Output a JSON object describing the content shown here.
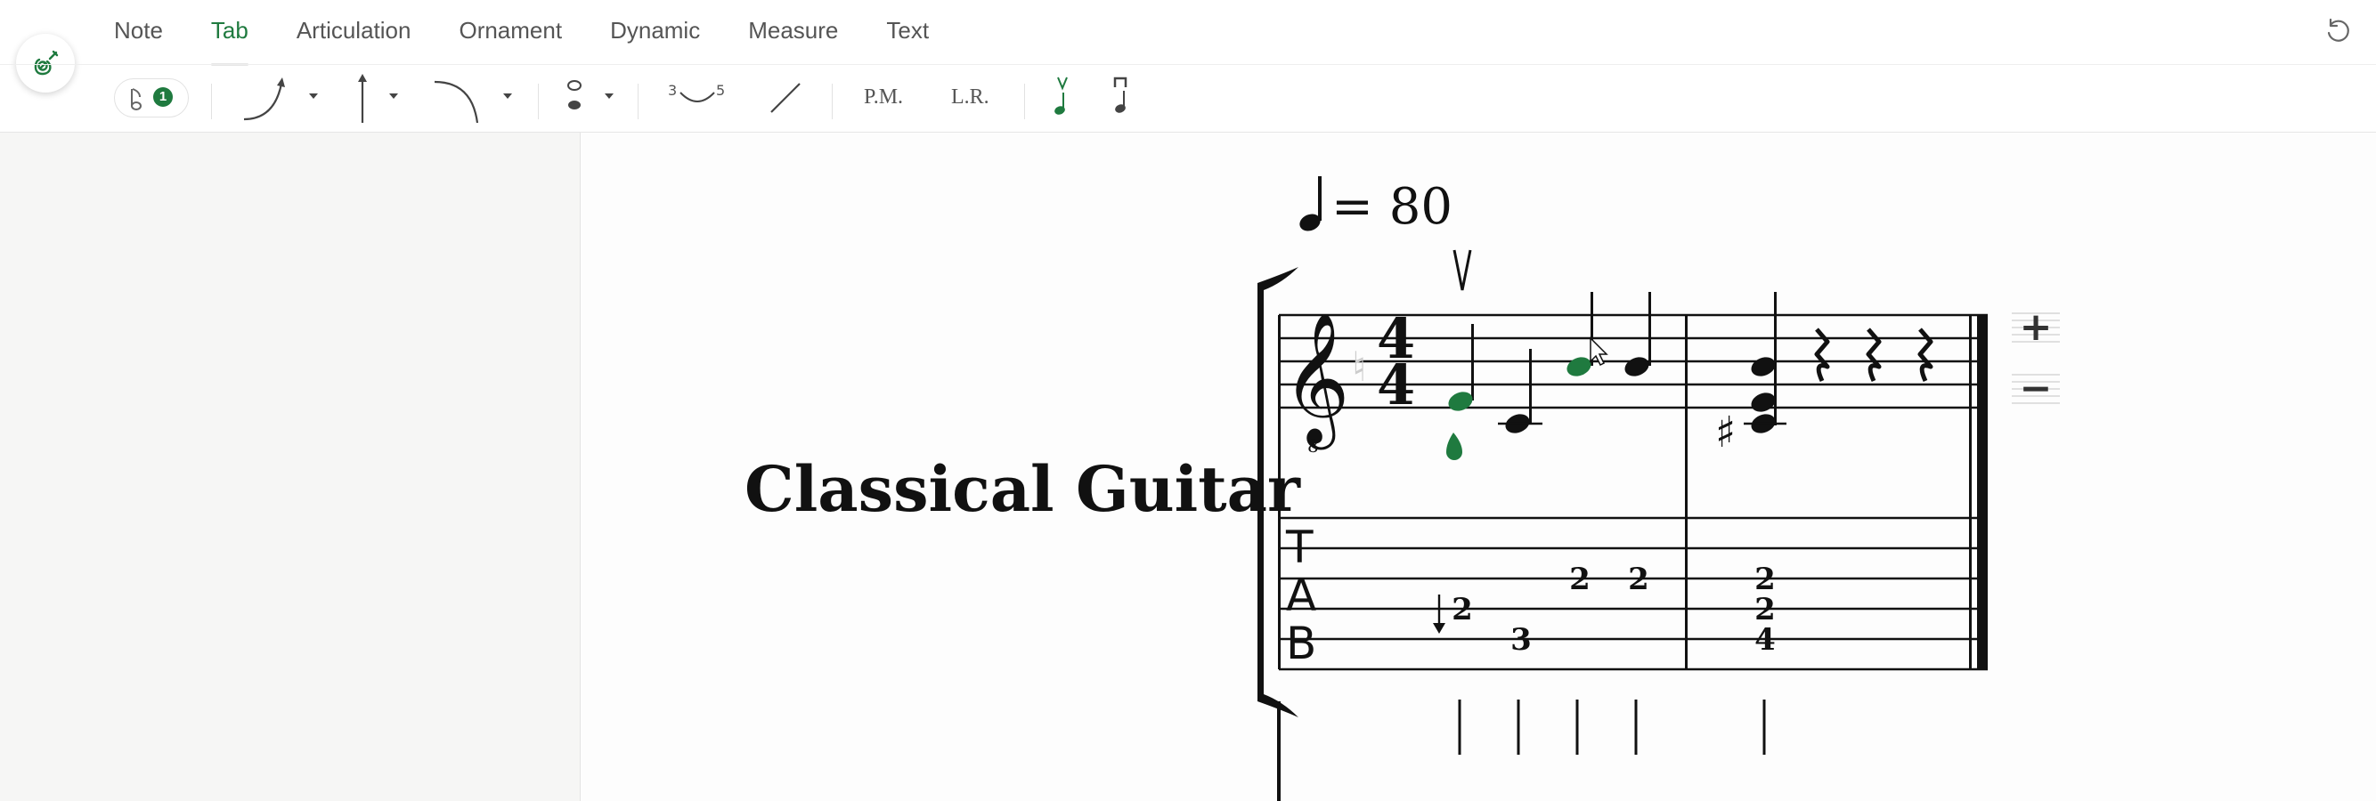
{
  "header": {
    "tabs": [
      {
        "label": "Note",
        "active": false
      },
      {
        "label": "Tab",
        "active": true
      },
      {
        "label": "Articulation",
        "active": false
      },
      {
        "label": "Ornament",
        "active": false
      },
      {
        "label": "Dynamic",
        "active": false
      },
      {
        "label": "Measure",
        "active": false
      },
      {
        "label": "Text",
        "active": false
      }
    ],
    "accent_color": "#1f7a3f"
  },
  "toolbar": {
    "voice_badge": "1",
    "triplet_left": "3",
    "triplet_right": "5",
    "palm_mute_label": "P.M.",
    "let_ring_label": "L.R.",
    "icons": [
      "guitar-icon",
      "voice-note-icon",
      "bend-icon",
      "arrow-up-icon",
      "release-curve-icon",
      "harmonic-note-icon",
      "slide-curve-icon",
      "slide-line-icon",
      "upstroke-icon",
      "downstroke-icon",
      "undo-icon"
    ]
  },
  "score": {
    "instrument_name": "Classical Guitar",
    "tempo": "= 80",
    "time_signature": "4/4",
    "tab_clef": [
      "T",
      "A",
      "B"
    ],
    "tab_numbers": {
      "measure1": [
        {
          "string": 4,
          "fret": "2"
        },
        {
          "string": 5,
          "fret": "3"
        },
        {
          "string": 3,
          "fret": "2"
        },
        {
          "string": 3,
          "fret": "2"
        }
      ],
      "measure2": [
        {
          "string": 3,
          "fret": "2"
        },
        {
          "string": 4,
          "fret": "2"
        },
        {
          "string": 5,
          "fret": "4"
        }
      ]
    },
    "selected_color": "#1f7a3f"
  },
  "staff_controls": {
    "add_label": "+",
    "remove_label": "−"
  }
}
